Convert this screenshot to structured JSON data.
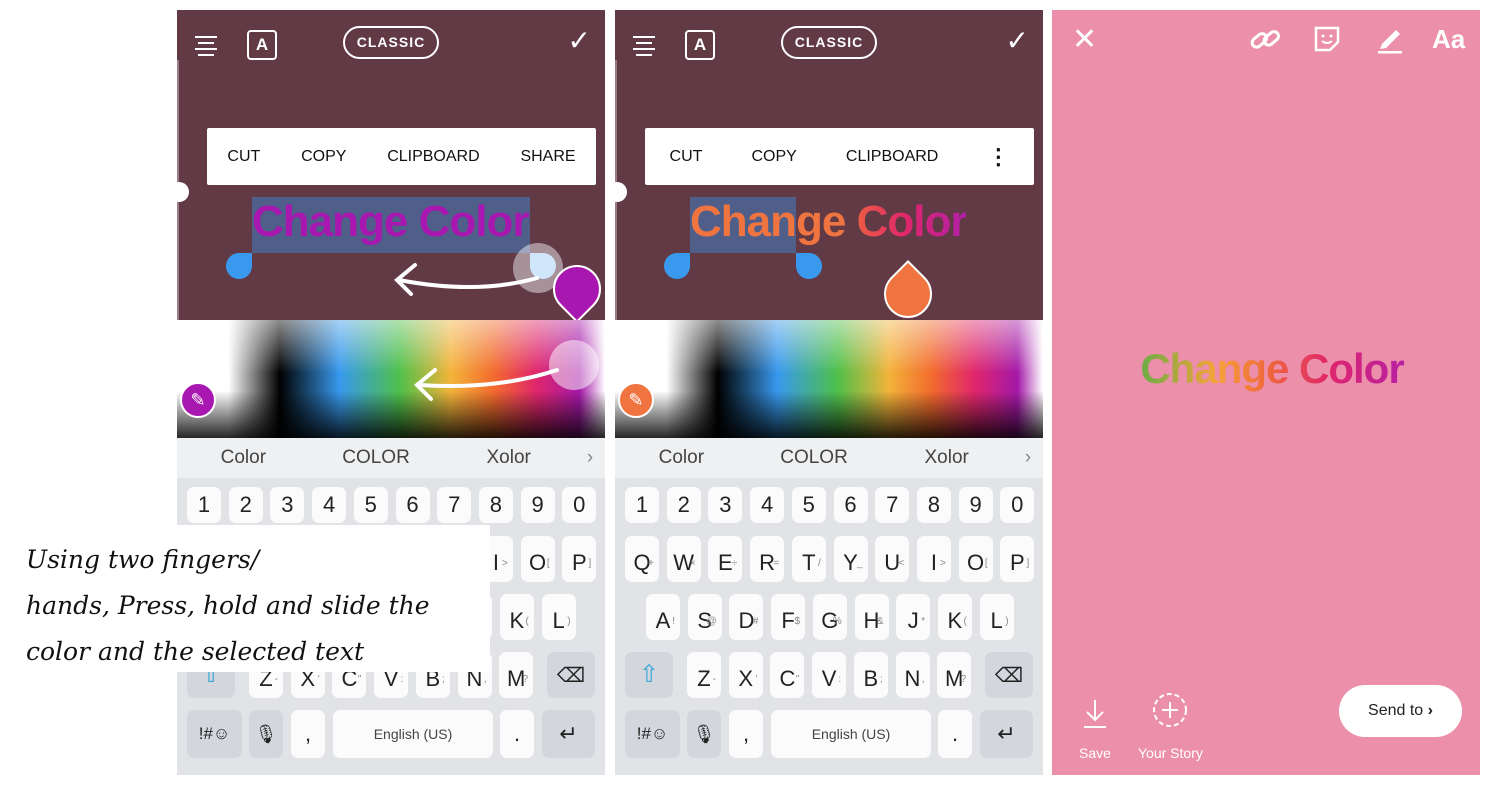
{
  "panels": [
    {
      "header": {
        "classic": "CLASSIC",
        "a_button": "A"
      },
      "context_menu": [
        "CUT",
        "COPY",
        "CLIPBOARD",
        "SHARE"
      ],
      "text": "Change Color",
      "text_color": "#a817b0",
      "selected_color": "#a817b0"
    },
    {
      "header": {
        "classic": "CLASSIC",
        "a_button": "A"
      },
      "context_menu": [
        "CUT",
        "COPY",
        "CLIPBOARD"
      ],
      "text_part1": "Change",
      "text_part2": " Color",
      "selected_color": "#f07440"
    }
  ],
  "suggestions": [
    "Color",
    "COLOR",
    "Xolor"
  ],
  "keyboard": {
    "numbers": [
      "1",
      "2",
      "3",
      "4",
      "5",
      "6",
      "7",
      "8",
      "9",
      "0"
    ],
    "row1": [
      "Q",
      "W",
      "E",
      "R",
      "T",
      "Y",
      "U",
      "I",
      "O",
      "P"
    ],
    "row1_sub": [
      "+",
      "×",
      "÷",
      "=",
      "/",
      "_",
      "<",
      ">",
      "[",
      "]"
    ],
    "row2": [
      "A",
      "S",
      "D",
      "F",
      "G",
      "H",
      "J",
      "K",
      "L"
    ],
    "row2_sub": [
      "!",
      "@",
      "#",
      "$",
      "%",
      "&",
      "*",
      "(",
      ")"
    ],
    "row3": [
      "Z",
      "X",
      "C",
      "V",
      "B",
      "N",
      "M"
    ],
    "row3_sub": [
      "-",
      "'",
      "\"",
      ":",
      ";",
      ",",
      "?"
    ],
    "symbols": "!#☺",
    "comma": ",",
    "space": "English (US)",
    "period": "."
  },
  "story": {
    "text": "Change Color",
    "save": "Save",
    "your_story": "Your Story",
    "send_to": "Send to",
    "text_icon": "Aa",
    "background": "#ec8fab"
  },
  "caption": {
    "line1": "Using two fingers/",
    "line2": "hands, Press, hold and slide the",
    "line3": "color and the selected text"
  }
}
